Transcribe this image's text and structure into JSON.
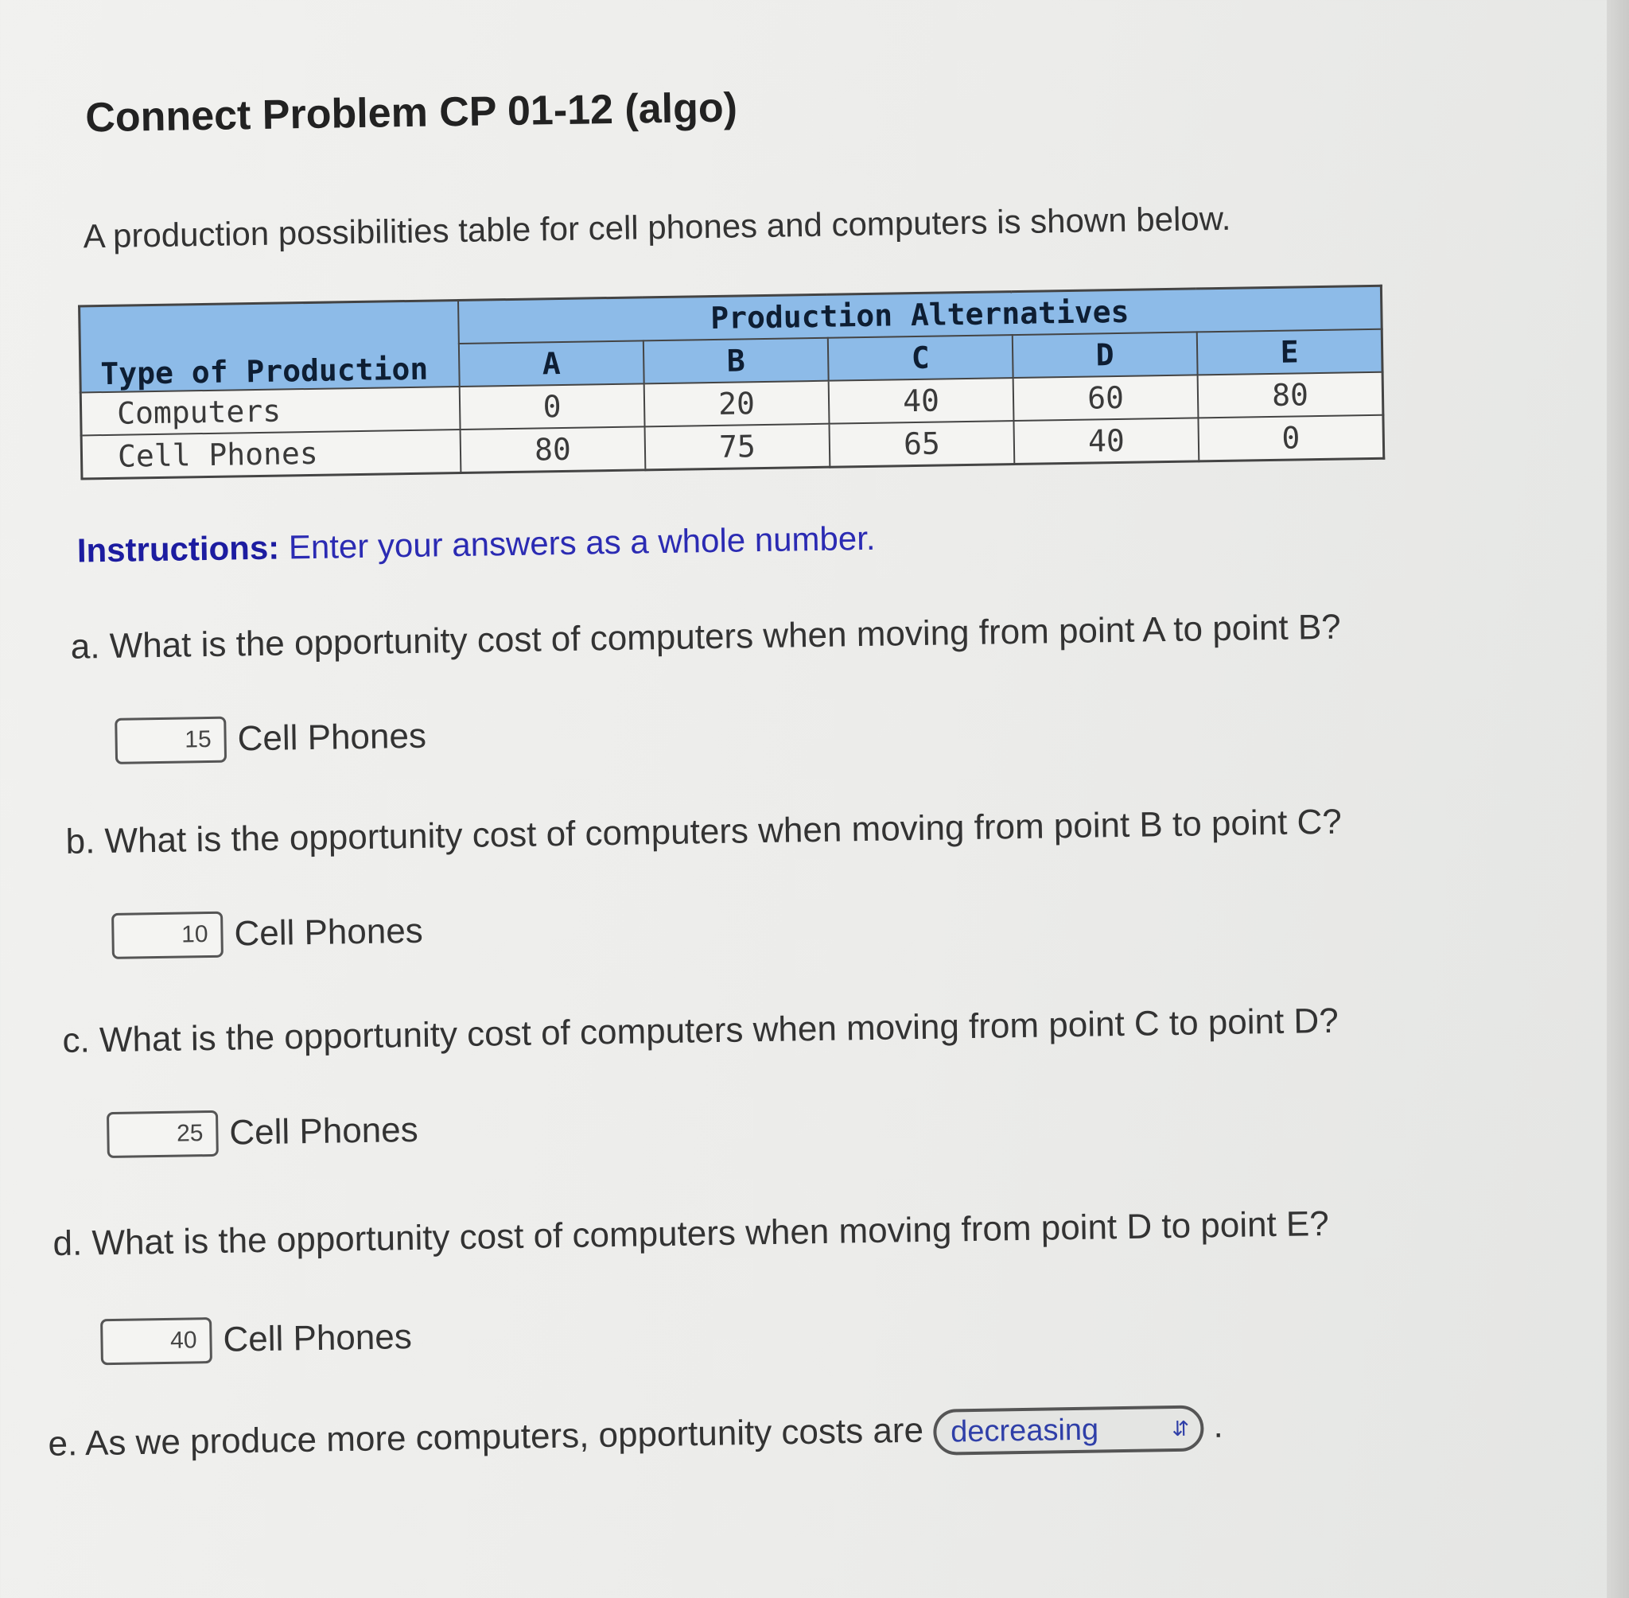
{
  "title": "Connect Problem CP 01-12 (algo)",
  "intro": "A production possibilities table for cell phones and computers is shown below.",
  "table": {
    "row_header": "Type of Production",
    "group_header": "Production Alternatives",
    "columns": [
      "A",
      "B",
      "C",
      "D",
      "E"
    ],
    "rows": [
      {
        "label": "Computers",
        "values": [
          "0",
          "20",
          "40",
          "60",
          "80"
        ]
      },
      {
        "label": "Cell Phones",
        "values": [
          "80",
          "75",
          "65",
          "40",
          "0"
        ]
      }
    ]
  },
  "instructions": {
    "label": "Instructions:",
    "text": "Enter your answers as a whole number."
  },
  "questions": [
    {
      "letter": "a.",
      "text": "What is the opportunity cost of computers when moving from point A to point B?",
      "answer": "15",
      "unit": "Cell Phones"
    },
    {
      "letter": "b.",
      "text": "What is the opportunity cost of computers when moving from point B to point C?",
      "answer": "10",
      "unit": "Cell Phones"
    },
    {
      "letter": "c.",
      "text": "What is the opportunity cost of computers when moving from point C to point D?",
      "answer": "25",
      "unit": "Cell Phones"
    },
    {
      "letter": "d.",
      "text": "What is the opportunity cost of computers when moving from point D to point E?",
      "answer": "40",
      "unit": "Cell Phones"
    }
  ],
  "question_e": {
    "letter": "e.",
    "text": "As we produce more computers, opportunity costs are",
    "selected": "decreasing",
    "arrow_icon": "updown-chevron-icon",
    "trailing": "."
  }
}
